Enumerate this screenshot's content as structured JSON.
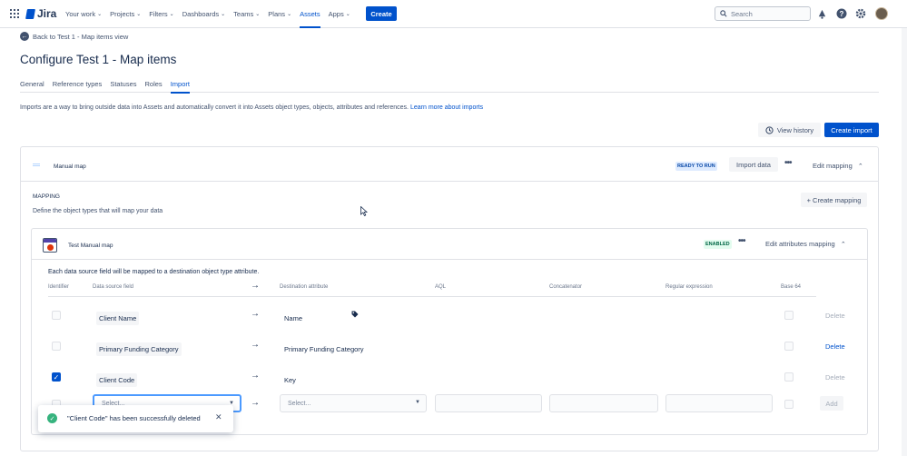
{
  "nav": {
    "product": "Jira",
    "items": [
      {
        "label": "Your work"
      },
      {
        "label": "Projects"
      },
      {
        "label": "Filters"
      },
      {
        "label": "Dashboards"
      },
      {
        "label": "Teams"
      },
      {
        "label": "Plans"
      },
      {
        "label": "Assets"
      },
      {
        "label": "Apps"
      }
    ],
    "active_item": "Assets",
    "create_label": "Create",
    "search_placeholder": "Search",
    "icons": [
      "app-switcher-icon",
      "notification-icon",
      "help-icon",
      "settings-icon",
      "avatar"
    ]
  },
  "page": {
    "back_link": "Back to Test 1 - Map items view",
    "title": "Configure Test 1 - Map items",
    "tabs": [
      "General",
      "Reference types",
      "Statuses",
      "Roles",
      "Import"
    ],
    "active_tab": "Import",
    "intro_text": "Imports are a way to bring outside data into Assets and automatically convert it into Assets object types, objects, attributes and references.",
    "intro_link": "Learn more about imports",
    "view_history_label": "View history",
    "create_import_label": "Create import"
  },
  "import_card": {
    "name": "Manual map",
    "status": "READY TO RUN",
    "import_data_label": "Import data",
    "more_label": "•••",
    "edit_mapping_label": "Edit mapping",
    "mapping_title": "MAPPING",
    "mapping_desc": "Define the object types that will map your data",
    "create_mapping_label": "+ Create mapping"
  },
  "object_mapping": {
    "name": "Test Manual map",
    "status": "ENABLED",
    "edit_attributes_label": "Edit attributes mapping",
    "description": "Each data source field will be mapped to a destination object type attribute.",
    "columns": [
      "Identifier",
      "Data source field",
      "Destination attribute",
      "AQL",
      "Concatenator",
      "Regular expression",
      "Base 64"
    ],
    "rows": [
      {
        "identifier": false,
        "source": "Client Name",
        "destination": "Name",
        "delete": "Delete",
        "delete_enabled": false
      },
      {
        "identifier": false,
        "source": "Primary Funding Category",
        "destination": "Primary Funding Category",
        "delete": "Delete",
        "delete_enabled": true
      },
      {
        "identifier": true,
        "source": "Client Code",
        "destination": "Key",
        "delete": "Delete",
        "delete_enabled": false
      }
    ],
    "new_row": {
      "source_placeholder": "Select...",
      "destination_placeholder": "Select...",
      "add_label": "Add"
    }
  },
  "toast": {
    "message": "\"Client Code\" has been successfully deleted"
  },
  "colors": {
    "brand": "#0052cc",
    "success": "#36b37e",
    "text": "#172b4d",
    "subtle": "#42526e"
  }
}
